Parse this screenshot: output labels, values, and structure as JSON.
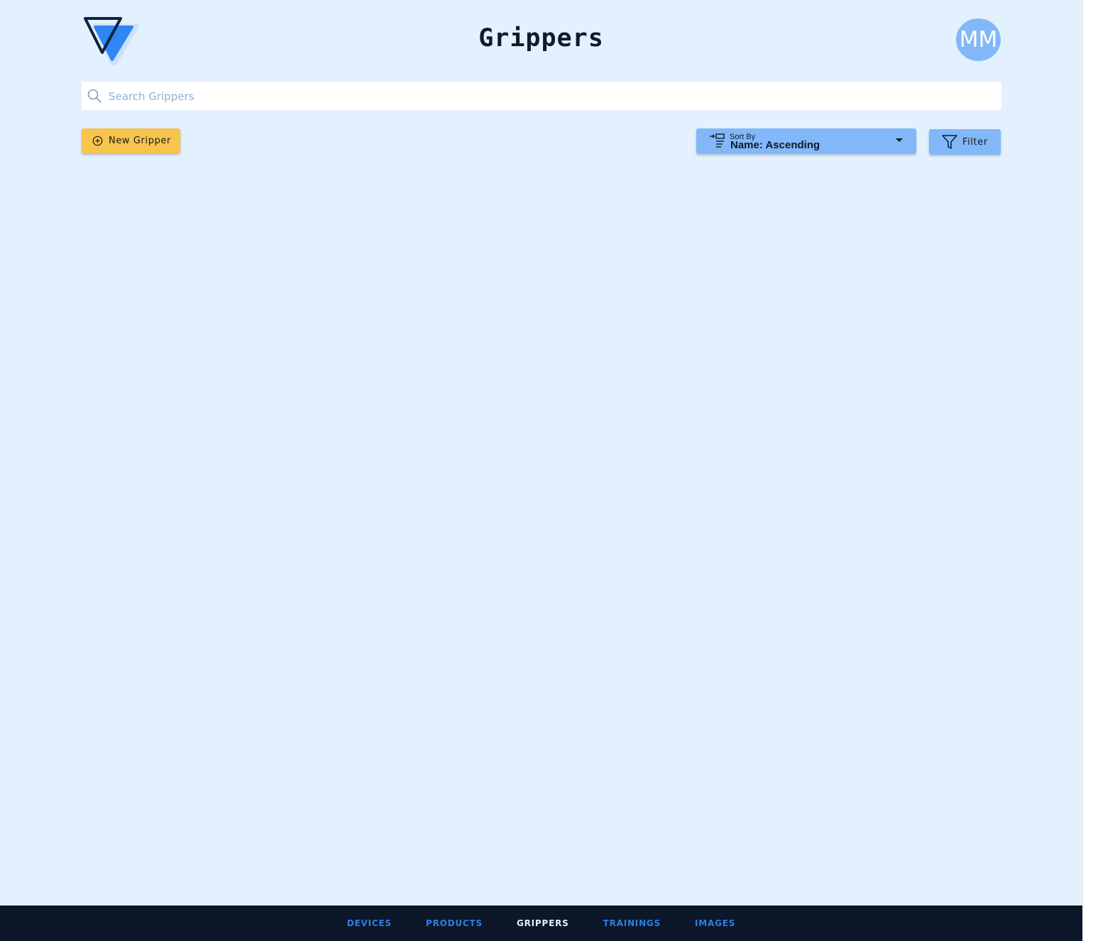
{
  "header": {
    "title": "Grippers",
    "logo_icon": "triangle-logo-icon",
    "avatar_initials": "MM"
  },
  "search": {
    "placeholder": "Search Grippers",
    "value": "",
    "icon": "search-icon"
  },
  "toolbar": {
    "new_label": "New Gripper",
    "new_icon": "plus-circle-icon",
    "sort_caption": "Sort By",
    "sort_value": "Name: Ascending",
    "sort_icon": "sort-list-icon",
    "filter_label": "Filter",
    "filter_icon": "funnel-icon"
  },
  "nav": {
    "items": [
      {
        "label": "DEVICES",
        "active": false
      },
      {
        "label": "PRODUCTS",
        "active": false
      },
      {
        "label": "GRIPPERS",
        "active": true
      },
      {
        "label": "TRAININGS",
        "active": false
      },
      {
        "label": "IMAGES",
        "active": false
      }
    ]
  },
  "colors": {
    "background": "#e3f0fd",
    "primary_button": "#f7c44d",
    "secondary_button": "#82b8f9",
    "nav_background": "#0c1729",
    "nav_link": "#2b7fe8",
    "nav_active": "#e6eef8"
  }
}
